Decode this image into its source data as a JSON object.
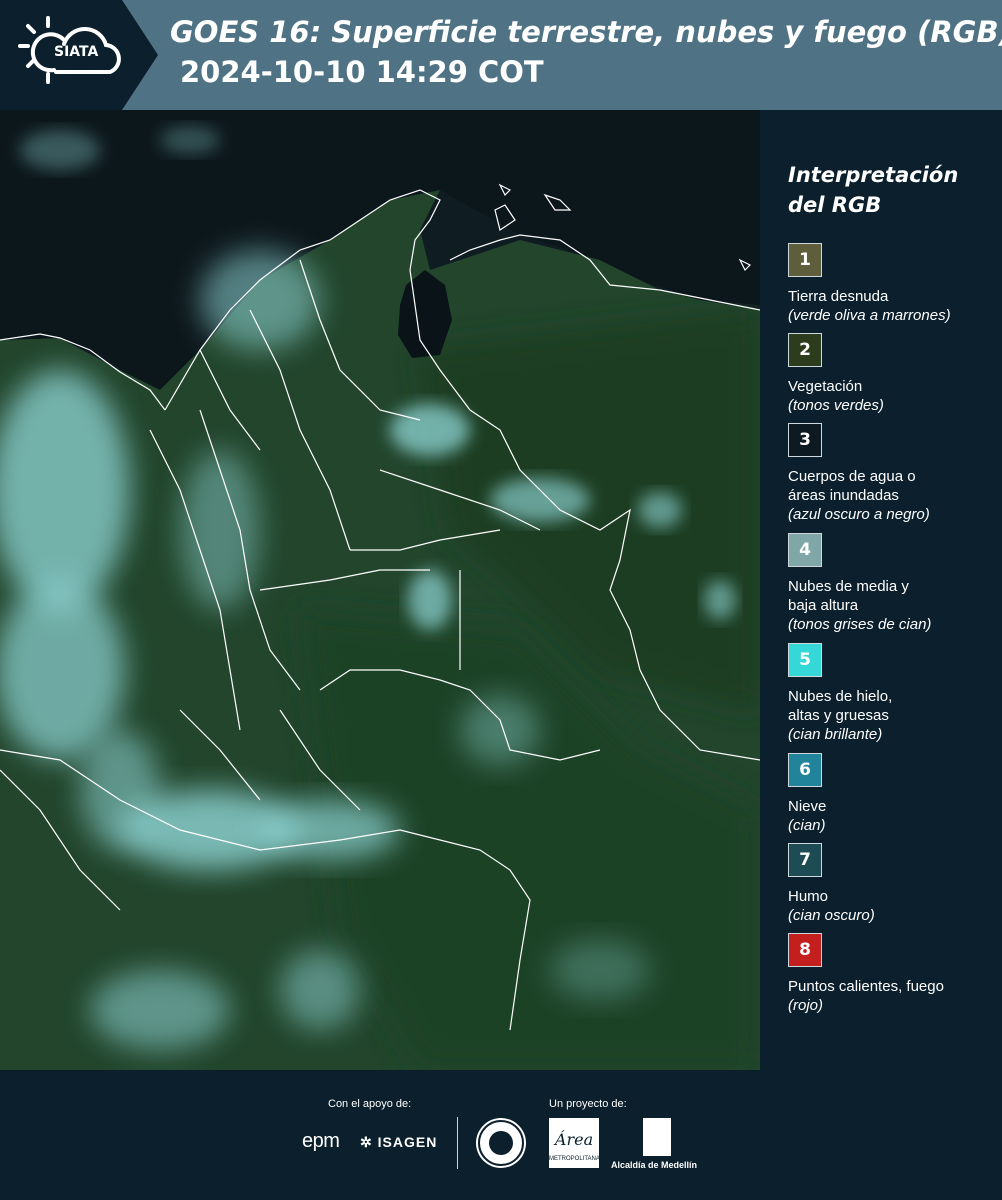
{
  "header": {
    "title_line1": "GOES 16: Superficie terrestre, nubes y fuego (RGB)",
    "title_line2": "2024-10-10 14:29 COT",
    "logo_text": "SIATA"
  },
  "legend": {
    "title_line1": "Interpretación",
    "title_line2": "del RGB",
    "items": [
      {
        "number": "1",
        "color": "#5e5e3c",
        "label": "Tierra desnuda",
        "desc": "(verde oliva a marrones)"
      },
      {
        "number": "2",
        "color": "#2b3d1c",
        "label": "Vegetación",
        "desc": "(tonos verdes)"
      },
      {
        "number": "3",
        "color": "#0d1a22",
        "label": "Cuerpos de agua o áreas inundadas",
        "desc": "(azul oscuro a negro)"
      },
      {
        "number": "4",
        "color": "#7fa7a8",
        "label": "Nubes de media y baja altura",
        "desc": "(tonos grises de cian)"
      },
      {
        "number": "5",
        "color": "#35d8d6",
        "label": "Nubes de hielo, altas y gruesas",
        "desc": "(cian brillante)"
      },
      {
        "number": "6",
        "color": "#22849b",
        "label": "Nieve",
        "desc": "(cian)"
      },
      {
        "number": "7",
        "color": "#1d4c54",
        "label": "Humo",
        "desc": "(cian oscuro)"
      },
      {
        "number": "8",
        "color": "#c31f1f",
        "label": "Puntos calientes, fuego",
        "desc": "(rojo)"
      }
    ]
  },
  "footer": {
    "support_label": "Con el apoyo de:",
    "project_label": "Un proyecto de:",
    "epm": "epm",
    "isagen": "ISAGEN",
    "area_logo": "Área",
    "area_sub": "METROPOLITANA",
    "medellin": "Alcaldía de Medellín"
  },
  "colors": {
    "background": "#0b1f2c",
    "header_band": "#4f7384",
    "ocean": "#0d1820",
    "vegetation": "#24492c",
    "cloud": "#8fd6d6"
  }
}
